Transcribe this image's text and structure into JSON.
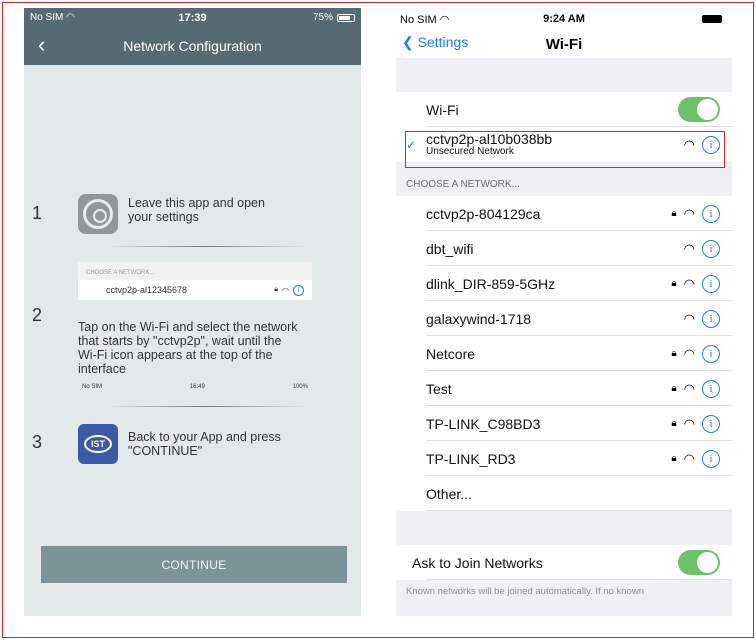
{
  "left": {
    "status": {
      "carrier": "No SIM",
      "time": "17:39",
      "battery": "75%"
    },
    "title": "Network Configuration",
    "steps": [
      {
        "num": "1",
        "text_l1": "Leave this app and open",
        "text_l2": "your settings"
      },
      {
        "num": "2",
        "mini_header": "CHOOSE A NETWORK...",
        "mini_network": "cctvp2p-al12345678",
        "text": [
          "Tap on the Wi-Fi and select the network",
          "that starts by \"cctvp2p\", wait until the",
          "Wi-Fi icon appears at the top of the",
          "interface"
        ],
        "mini_status": {
          "carrier": "No SIM",
          "time": "16:49",
          "battery": "100%"
        }
      },
      {
        "num": "3",
        "logo": "IST",
        "text_l1": "Back to your App and press",
        "text_l2": "\"CONTINUE\""
      }
    ],
    "continue_label": "CONTINUE"
  },
  "right": {
    "status": {
      "carrier": "No SIM",
      "time": "9:24 AM"
    },
    "back_label": "Settings",
    "title": "Wi-Fi",
    "wifi_label": "Wi-Fi",
    "connected": {
      "name": "cctvp2p-al10b038bb",
      "sub": "Unsecured Network"
    },
    "section_header": "CHOOSE A NETWORK...",
    "networks": [
      {
        "name": "cctvp2p-804129ca",
        "locked": true
      },
      {
        "name": "dbt_wifi",
        "locked": false
      },
      {
        "name": "dlink_DIR-859-5GHz",
        "locked": true
      },
      {
        "name": "galaxywind-1718",
        "locked": false
      },
      {
        "name": "Netcore",
        "locked": true
      },
      {
        "name": "Test",
        "locked": true
      },
      {
        "name": "TP-LINK_C98BD3",
        "locked": true
      },
      {
        "name": "TP-LINK_RD3",
        "locked": true
      }
    ],
    "other_label": "Other...",
    "ask_label": "Ask to Join Networks",
    "footer": "Known networks will be joined automatically. If no known"
  },
  "icons": {
    "wifi": "wifi-icon",
    "lock": "lock-icon",
    "info": "info-icon",
    "check": "checkmark-icon"
  }
}
